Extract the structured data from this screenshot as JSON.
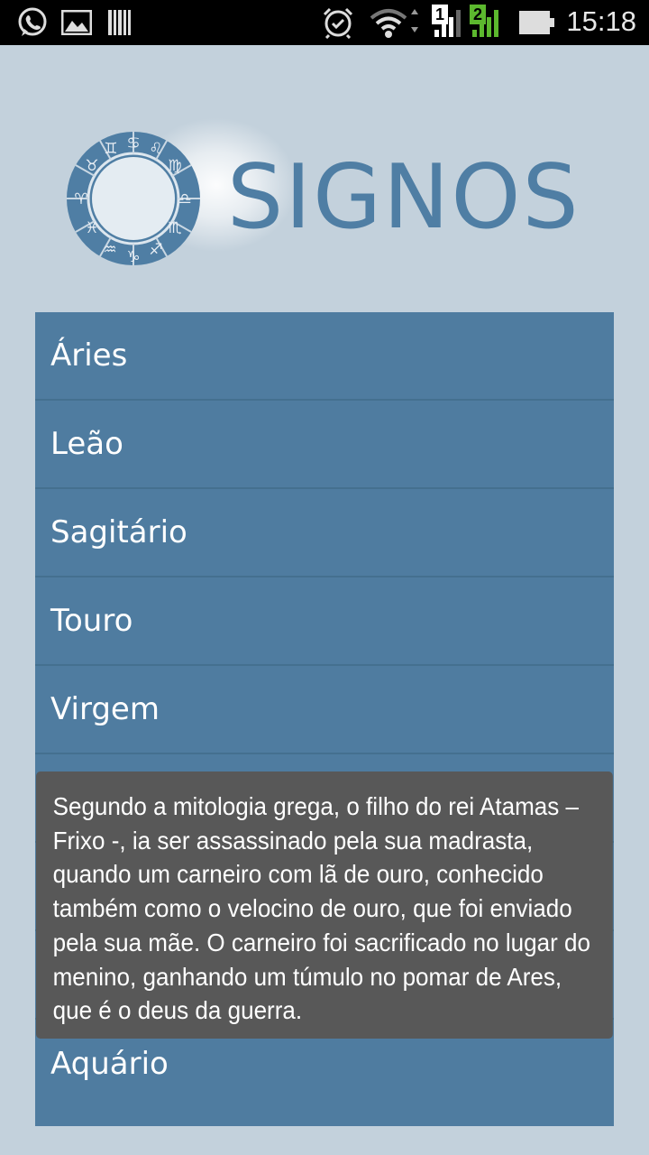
{
  "status_bar": {
    "time": "15:18",
    "sim1_label": "1",
    "sim2_label": "2"
  },
  "header": {
    "logo_text": "SIGNOS"
  },
  "signs": [
    {
      "label": "Áries"
    },
    {
      "label": "Leão"
    },
    {
      "label": "Sagitário"
    },
    {
      "label": "Touro"
    },
    {
      "label": "Virgem"
    },
    {
      "label": ""
    },
    {
      "label": ""
    },
    {
      "label": ""
    },
    {
      "label": "Aquário"
    }
  ],
  "toast": {
    "text": "Segundo a mitologia grega, o filho do rei Atamas – Frixo -, ia ser assassinado pela sua madrasta, quando um carneiro com lã de ouro, conhecido também como o velocino de ouro, que foi enviado pela sua mãe. O carneiro foi sacrificado no lugar do menino, ganhando um túmulo no pomar de Ares, que é o deus da guerra."
  },
  "colors": {
    "background": "#c3d1dc",
    "list_item": "#4f7ca0",
    "logo": "#4f7ea4",
    "toast": "#585858"
  }
}
